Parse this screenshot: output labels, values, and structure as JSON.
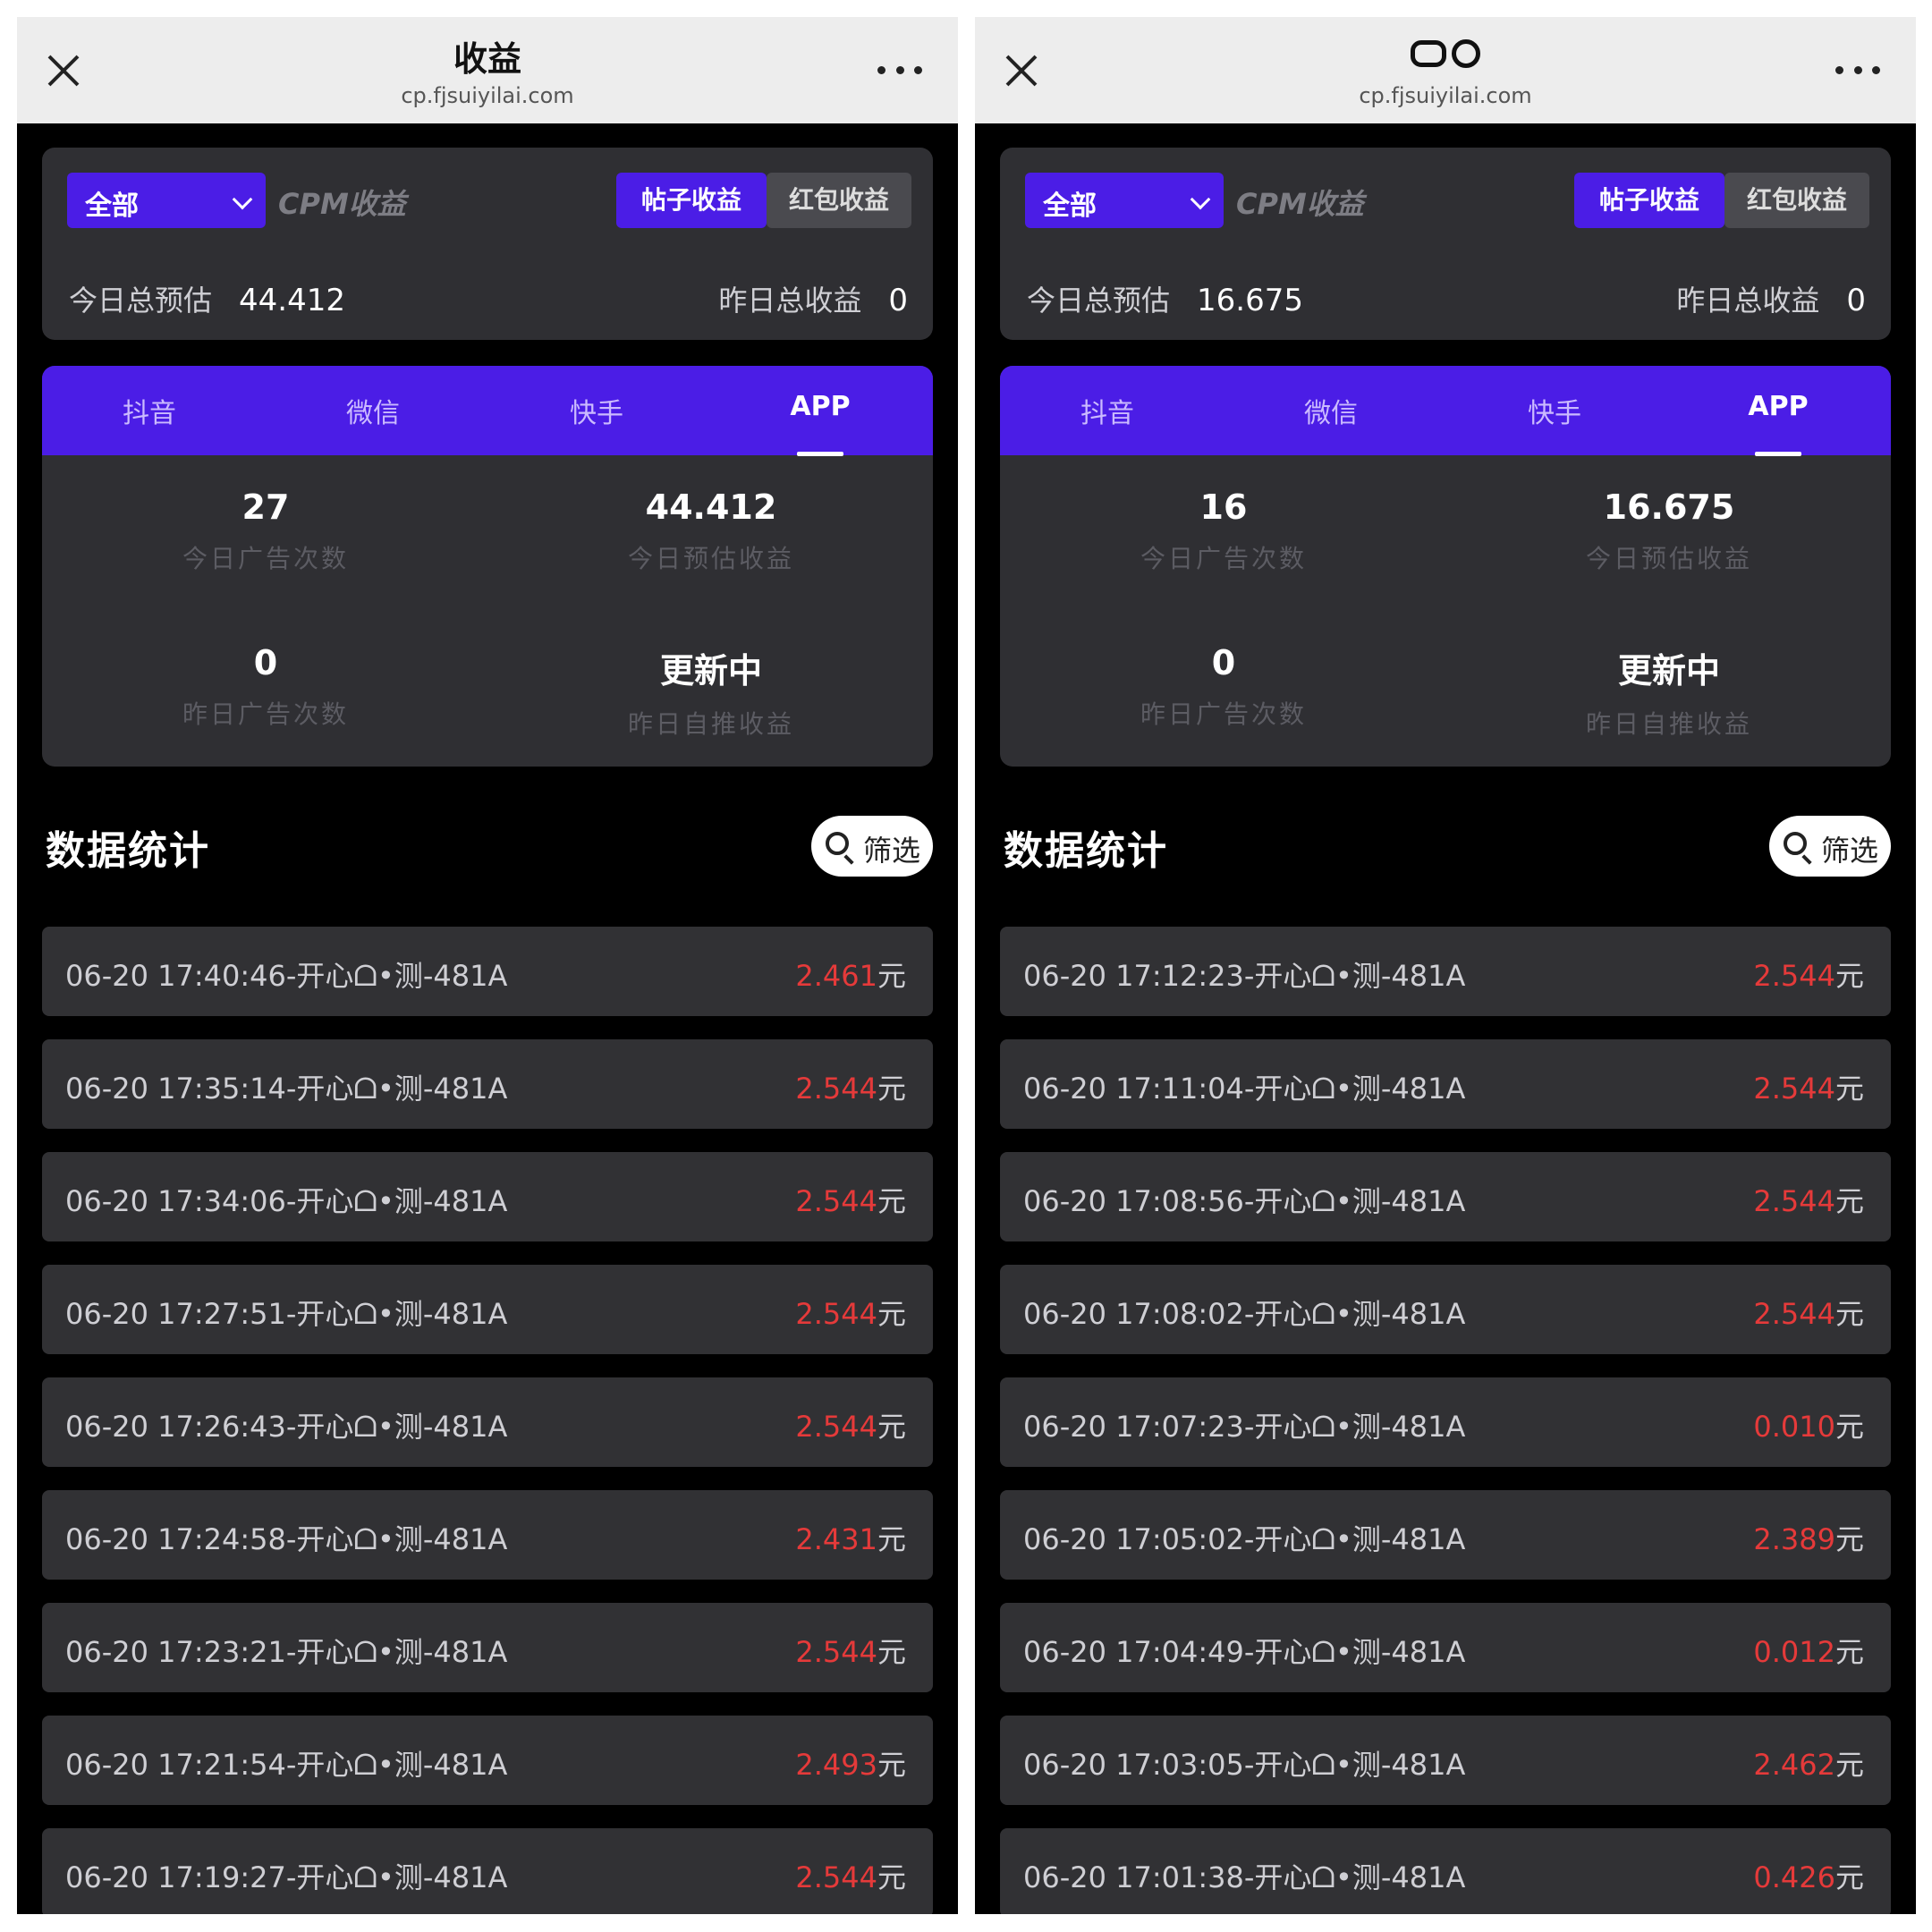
{
  "panels": [
    {
      "header": {
        "title": "收益",
        "url": "cp.fjsuiyilai.com"
      },
      "top": {
        "scope": "全部",
        "cpm_label": "CPM收益",
        "seg_post": "帖子收益",
        "seg_red": "红包收益",
        "today_label": "今日总预估",
        "today_value": "44.412",
        "yesterday_label": "昨日总收益",
        "yesterday_value": "0"
      },
      "tabs": [
        "抖音",
        "微信",
        "快手",
        "APP"
      ],
      "metrics": [
        {
          "value": "27",
          "label": "今日广告次数"
        },
        {
          "value": "44.412",
          "label": "今日预估收益"
        },
        {
          "value": "0",
          "label": "昨日广告次数"
        },
        {
          "value": "更新中",
          "label": "昨日自推收益"
        }
      ],
      "section_title": "数据统计",
      "filter_label": "筛选",
      "records": [
        {
          "text": "06-20 17:40:46-开心ᗝ•测-481A",
          "amount": "2.461",
          "unit": "元"
        },
        {
          "text": "06-20 17:35:14-开心ᗝ•测-481A",
          "amount": "2.544",
          "unit": "元"
        },
        {
          "text": "06-20 17:34:06-开心ᗝ•测-481A",
          "amount": "2.544",
          "unit": "元"
        },
        {
          "text": "06-20 17:27:51-开心ᗝ•测-481A",
          "amount": "2.544",
          "unit": "元"
        },
        {
          "text": "06-20 17:26:43-开心ᗝ•测-481A",
          "amount": "2.544",
          "unit": "元"
        },
        {
          "text": "06-20 17:24:58-开心ᗝ•测-481A",
          "amount": "2.431",
          "unit": "元"
        },
        {
          "text": "06-20 17:23:21-开心ᗝ•测-481A",
          "amount": "2.544",
          "unit": "元"
        },
        {
          "text": "06-20 17:21:54-开心ᗝ•测-481A",
          "amount": "2.493",
          "unit": "元"
        },
        {
          "text": "06-20 17:19:27-开心ᗝ•测-481A",
          "amount": "2.544",
          "unit": "元"
        }
      ]
    },
    {
      "header": {
        "title": "",
        "url": "cp.fjsuiyilai.com"
      },
      "top": {
        "scope": "全部",
        "cpm_label": "CPM收益",
        "seg_post": "帖子收益",
        "seg_red": "红包收益",
        "today_label": "今日总预估",
        "today_value": "16.675",
        "yesterday_label": "昨日总收益",
        "yesterday_value": "0"
      },
      "tabs": [
        "抖音",
        "微信",
        "快手",
        "APP"
      ],
      "metrics": [
        {
          "value": "16",
          "label": "今日广告次数"
        },
        {
          "value": "16.675",
          "label": "今日预估收益"
        },
        {
          "value": "0",
          "label": "昨日广告次数"
        },
        {
          "value": "更新中",
          "label": "昨日自推收益"
        }
      ],
      "section_title": "数据统计",
      "filter_label": "筛选",
      "records": [
        {
          "text": "06-20 17:12:23-开心ᗝ•测-481A",
          "amount": "2.544",
          "unit": "元"
        },
        {
          "text": "06-20 17:11:04-开心ᗝ•测-481A",
          "amount": "2.544",
          "unit": "元"
        },
        {
          "text": "06-20 17:08:56-开心ᗝ•测-481A",
          "amount": "2.544",
          "unit": "元"
        },
        {
          "text": "06-20 17:08:02-开心ᗝ•测-481A",
          "amount": "2.544",
          "unit": "元"
        },
        {
          "text": "06-20 17:07:23-开心ᗝ•测-481A",
          "amount": "0.010",
          "unit": "元"
        },
        {
          "text": "06-20 17:05:02-开心ᗝ•测-481A",
          "amount": "2.389",
          "unit": "元"
        },
        {
          "text": "06-20 17:04:49-开心ᗝ•测-481A",
          "amount": "0.012",
          "unit": "元"
        },
        {
          "text": "06-20 17:03:05-开心ᗝ•测-481A",
          "amount": "2.462",
          "unit": "元"
        },
        {
          "text": "06-20 17:01:38-开心ᗝ•测-481A",
          "amount": "0.426",
          "unit": "元"
        }
      ]
    }
  ],
  "colors": {
    "accent": "#4b1de6",
    "amount": "#e53a3a",
    "card": "#2f2f33",
    "background": "#000000"
  },
  "icons": {
    "close": "close-icon",
    "more": "more-icon",
    "dropdown": "chevron-down-icon",
    "search": "search-icon"
  }
}
